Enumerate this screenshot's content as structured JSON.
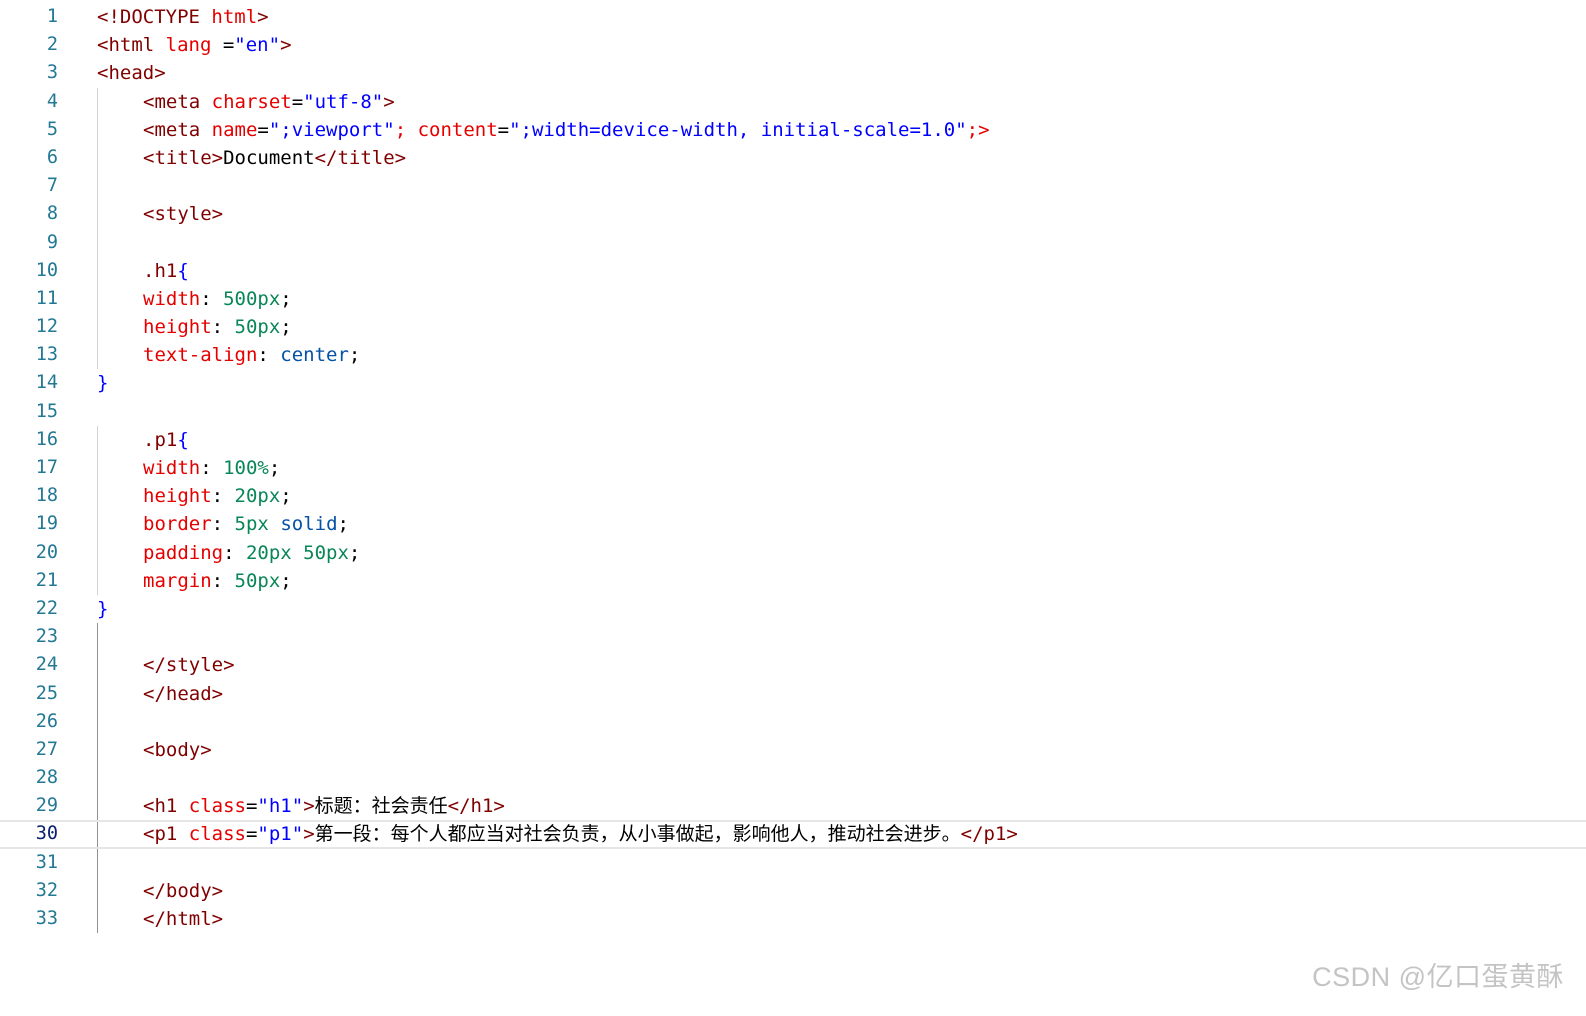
{
  "editor": {
    "current_line": 30,
    "lines": [
      {
        "n": "1",
        "indent": 0,
        "tokens": [
          {
            "t": "<!DOCTYPE ",
            "c": "tag"
          },
          {
            "t": "html",
            "c": "attr"
          },
          {
            "t": ">",
            "c": "tag"
          }
        ]
      },
      {
        "n": "2",
        "indent": 0,
        "tokens": [
          {
            "t": "<html ",
            "c": "tag"
          },
          {
            "t": "lang",
            "c": "attr"
          },
          {
            "t": " =",
            "c": "text"
          },
          {
            "t": "\"en\"",
            "c": "str"
          },
          {
            "t": ">",
            "c": "tag"
          }
        ]
      },
      {
        "n": "3",
        "indent": 0,
        "tokens": [
          {
            "t": "<head>",
            "c": "tag"
          }
        ]
      },
      {
        "n": "4",
        "indent": 1,
        "tokens": [
          {
            "t": "<meta ",
            "c": "tag"
          },
          {
            "t": "charset",
            "c": "attr"
          },
          {
            "t": "=",
            "c": "text"
          },
          {
            "t": "\"utf-8\"",
            "c": "str"
          },
          {
            "t": ">",
            "c": "tag"
          }
        ]
      },
      {
        "n": "5",
        "indent": 1,
        "tokens": [
          {
            "t": "<meta ",
            "c": "tag"
          },
          {
            "t": "name",
            "c": "attr"
          },
          {
            "t": "=",
            "c": "text"
          },
          {
            "t": "\";viewport\"",
            "c": "str"
          },
          {
            "t": "; content",
            "c": "attr"
          },
          {
            "t": "=",
            "c": "text"
          },
          {
            "t": "\";width=device-width, initial-scale=1.0\"",
            "c": "str"
          },
          {
            "t": ";>",
            "c": "attr"
          }
        ]
      },
      {
        "n": "6",
        "indent": 1,
        "tokens": [
          {
            "t": "<title>",
            "c": "tag"
          },
          {
            "t": "Document",
            "c": "text"
          },
          {
            "t": "</title>",
            "c": "tag"
          }
        ]
      },
      {
        "n": "7",
        "indent": 1,
        "tokens": []
      },
      {
        "n": "8",
        "indent": 1,
        "tokens": [
          {
            "t": "<style>",
            "c": "tag"
          }
        ]
      },
      {
        "n": "9",
        "indent": 1,
        "tokens": []
      },
      {
        "n": "10",
        "indent": 1,
        "tokens": [
          {
            "t": ".h1",
            "c": "tag"
          },
          {
            "t": "{",
            "c": "brace"
          }
        ]
      },
      {
        "n": "11",
        "indent": 1,
        "tokens": [
          {
            "t": "width",
            "c": "prop"
          },
          {
            "t": ": ",
            "c": "text"
          },
          {
            "t": "500px",
            "c": "num"
          },
          {
            "t": ";",
            "c": "text"
          }
        ]
      },
      {
        "n": "12",
        "indent": 1,
        "tokens": [
          {
            "t": "height",
            "c": "prop"
          },
          {
            "t": ": ",
            "c": "text"
          },
          {
            "t": "50px",
            "c": "num"
          },
          {
            "t": ";",
            "c": "text"
          }
        ]
      },
      {
        "n": "13",
        "indent": 1,
        "tokens": [
          {
            "t": "text-align",
            "c": "prop"
          },
          {
            "t": ": ",
            "c": "text"
          },
          {
            "t": "center",
            "c": "val"
          },
          {
            "t": ";",
            "c": "text"
          }
        ]
      },
      {
        "n": "14",
        "indent": 0,
        "tokens": [
          {
            "t": "}",
            "c": "brace"
          }
        ]
      },
      {
        "n": "15",
        "indent": 0,
        "tokens": []
      },
      {
        "n": "16",
        "indent": 1,
        "tokens": [
          {
            "t": ".p1",
            "c": "tag"
          },
          {
            "t": "{",
            "c": "brace"
          }
        ]
      },
      {
        "n": "17",
        "indent": 1,
        "tokens": [
          {
            "t": "width",
            "c": "prop"
          },
          {
            "t": ": ",
            "c": "text"
          },
          {
            "t": "100%",
            "c": "num"
          },
          {
            "t": ";",
            "c": "text"
          }
        ]
      },
      {
        "n": "18",
        "indent": 1,
        "tokens": [
          {
            "t": "height",
            "c": "prop"
          },
          {
            "t": ": ",
            "c": "text"
          },
          {
            "t": "20px",
            "c": "num"
          },
          {
            "t": ";",
            "c": "text"
          }
        ]
      },
      {
        "n": "19",
        "indent": 1,
        "tokens": [
          {
            "t": "border",
            "c": "prop"
          },
          {
            "t": ": ",
            "c": "text"
          },
          {
            "t": "5px",
            "c": "num"
          },
          {
            "t": " ",
            "c": "text"
          },
          {
            "t": "solid",
            "c": "val"
          },
          {
            "t": ";",
            "c": "text"
          }
        ]
      },
      {
        "n": "20",
        "indent": 1,
        "tokens": [
          {
            "t": "padding",
            "c": "prop"
          },
          {
            "t": ": ",
            "c": "text"
          },
          {
            "t": "20px 50px",
            "c": "num"
          },
          {
            "t": ";",
            "c": "text"
          }
        ]
      },
      {
        "n": "21",
        "indent": 1,
        "tokens": [
          {
            "t": "margin",
            "c": "prop"
          },
          {
            "t": ": ",
            "c": "text"
          },
          {
            "t": "50px",
            "c": "num"
          },
          {
            "t": ";",
            "c": "text"
          }
        ]
      },
      {
        "n": "22",
        "indent": 0,
        "tokens": [
          {
            "t": "}",
            "c": "brace"
          }
        ]
      },
      {
        "n": "23",
        "indent": 1,
        "tokens": []
      },
      {
        "n": "24",
        "indent": 1,
        "tokens": [
          {
            "t": "</style>",
            "c": "tag"
          }
        ]
      },
      {
        "n": "25",
        "indent": 1,
        "tokens": [
          {
            "t": "</head>",
            "c": "tag"
          }
        ]
      },
      {
        "n": "26",
        "indent": 1,
        "tokens": []
      },
      {
        "n": "27",
        "indent": 1,
        "tokens": [
          {
            "t": "<body>",
            "c": "tag"
          }
        ]
      },
      {
        "n": "28",
        "indent": 1,
        "tokens": []
      },
      {
        "n": "29",
        "indent": 1,
        "tokens": [
          {
            "t": "<h1 ",
            "c": "tag"
          },
          {
            "t": "class",
            "c": "attr"
          },
          {
            "t": "=",
            "c": "text"
          },
          {
            "t": "\"h1\"",
            "c": "str"
          },
          {
            "t": ">",
            "c": "tag"
          },
          {
            "t": "标题：社会责任",
            "c": "cjk"
          },
          {
            "t": "</h1>",
            "c": "tag"
          }
        ]
      },
      {
        "n": "30",
        "indent": 1,
        "tokens": [
          {
            "t": "<p1 ",
            "c": "tag"
          },
          {
            "t": "class",
            "c": "attr"
          },
          {
            "t": "=",
            "c": "text"
          },
          {
            "t": "\"p1\"",
            "c": "str"
          },
          {
            "t": ">",
            "c": "tag"
          },
          {
            "t": "第一段：每个人都应当对社会负责，从小事做起，影响他人，推动社会进步。",
            "c": "cjk"
          },
          {
            "t": "</p1>",
            "c": "tag"
          }
        ]
      },
      {
        "n": "31",
        "indent": 1,
        "tokens": []
      },
      {
        "n": "32",
        "indent": 1,
        "tokens": [
          {
            "t": "</body>",
            "c": "tag"
          }
        ]
      },
      {
        "n": "33",
        "indent": 1,
        "tokens": [
          {
            "t": "</html>",
            "c": "tag"
          }
        ]
      }
    ]
  },
  "watermark": "CSDN @亿口蛋黄酥"
}
